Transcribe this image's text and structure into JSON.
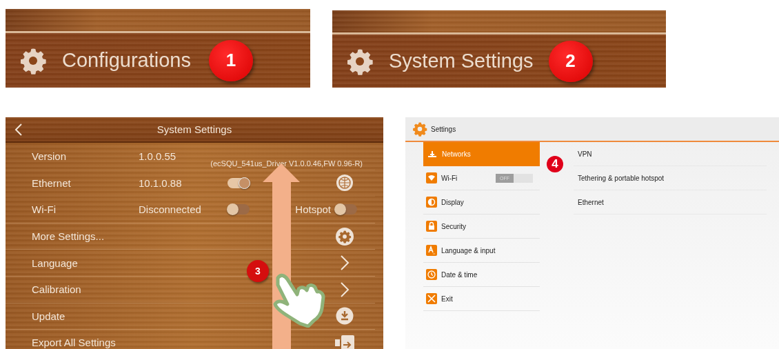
{
  "banners": [
    {
      "label": "Configurations",
      "badge": "1"
    },
    {
      "label": "System Settings",
      "badge": "2"
    }
  ],
  "system_settings": {
    "title": "System Settings",
    "badge": "3",
    "rows": [
      {
        "kind": "info",
        "label": "Version",
        "value": "1.0.0.55",
        "note": "(ecSQU_541us_Driver  V1.0.0.46,FW 0.96-R)"
      },
      {
        "kind": "network",
        "label": "Ethernet",
        "value": "10.1.0.88",
        "on": true
      },
      {
        "kind": "wifi",
        "label": "Wi-Fi",
        "value": "Disconnected",
        "on": false,
        "hotspot": {
          "label": "Hotspot",
          "on": false
        }
      },
      {
        "kind": "gear",
        "label": "More Settings..."
      },
      {
        "kind": "link",
        "label": "Language"
      },
      {
        "kind": "link",
        "label": "Calibration"
      },
      {
        "kind": "update",
        "label": "Update"
      },
      {
        "kind": "export",
        "label": "Export All Settings"
      }
    ]
  },
  "settings": {
    "title": "Settings",
    "badge": "4",
    "menu": [
      {
        "kind": "networks",
        "label": "Networks",
        "selected": true
      },
      {
        "kind": "wifi",
        "label": "Wi-Fi",
        "selected": false,
        "toggle": {
          "label": "OFF",
          "on": false
        }
      },
      {
        "kind": "display",
        "label": "Display",
        "selected": false
      },
      {
        "kind": "security",
        "label": "Security",
        "selected": false
      },
      {
        "kind": "language",
        "label": "Language & input",
        "selected": false
      },
      {
        "kind": "clock",
        "label": "Date & time",
        "selected": false
      },
      {
        "kind": "exit",
        "label": "Exit",
        "selected": false
      }
    ],
    "items": [
      "VPN",
      "Tethering & portable hotspot",
      "Ethernet"
    ]
  }
}
